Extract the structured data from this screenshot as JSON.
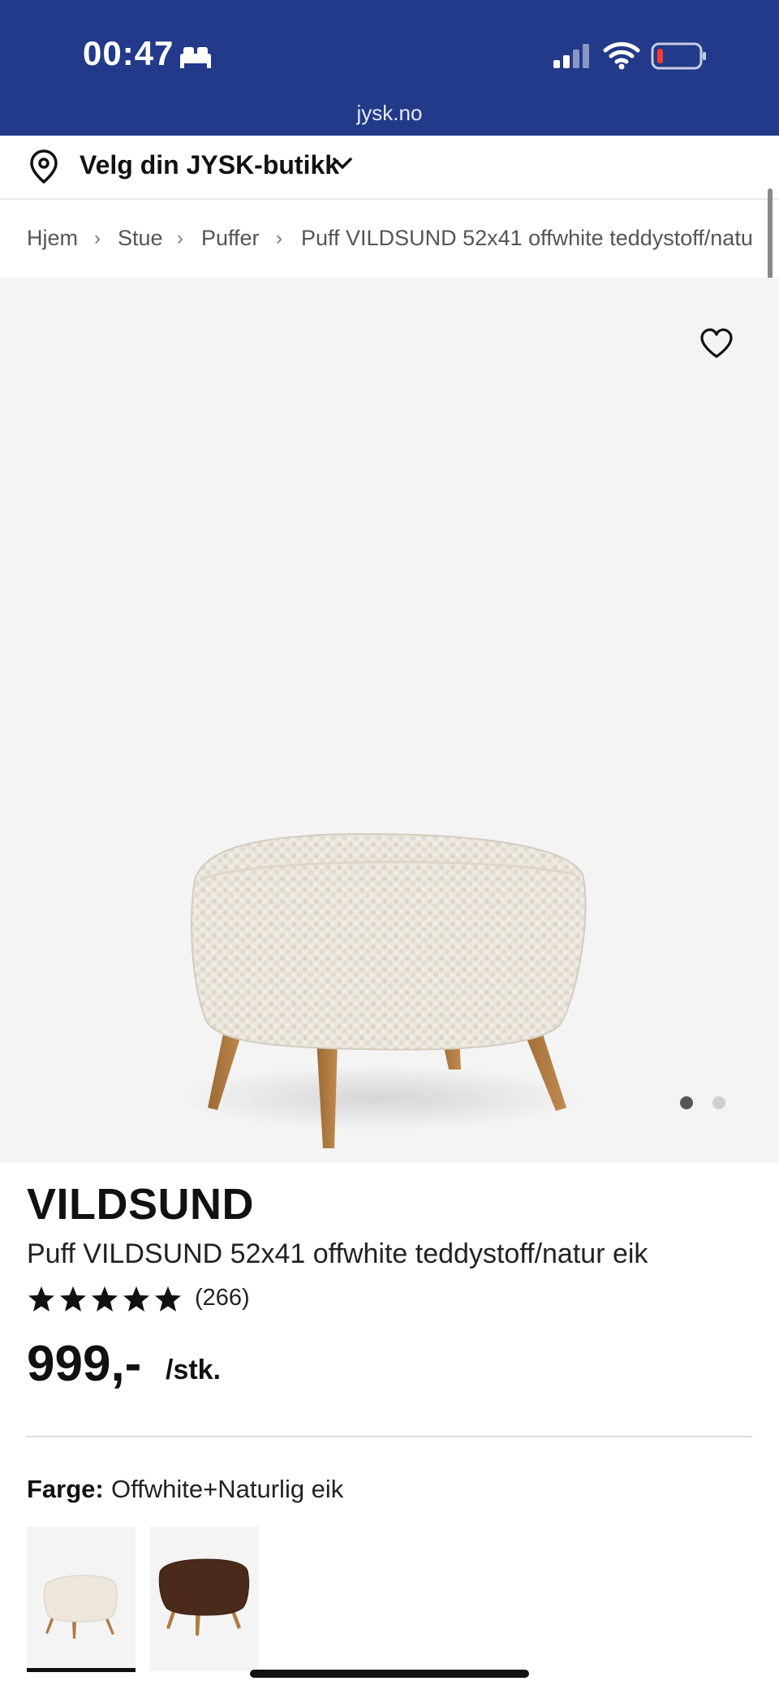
{
  "status_bar": {
    "time": "00:47",
    "icons": [
      "bed-icon",
      "signal-icon",
      "wifi-icon",
      "battery-low-icon"
    ],
    "url": "jysk.no",
    "bg_color": "#233a8a"
  },
  "store_selector": {
    "label": "Velg din JYSK-butikk",
    "icon": "map-pin-icon"
  },
  "breadcrumb": {
    "items": [
      "Hjem",
      "Stue",
      "Puffer",
      "Puff VILDSUND 52x41 offwhite teddystoff/natu"
    ]
  },
  "gallery": {
    "favorite_icon": "heart-outline-icon",
    "image_alt": "Puff VILDSUND offwhite teddystoff",
    "dots_count": 2,
    "active_dot": 1
  },
  "product": {
    "brand": "VILDSUND",
    "title": "Puff VILDSUND 52x41 offwhite teddystoff/natur eik",
    "rating": 5,
    "review_count": "(266)",
    "price": "999,-",
    "unit": "/stk.",
    "color_label": "Farge:",
    "color_value": "Offwhite+Naturlig eik",
    "swatches": [
      "Offwhite+Naturlig eik",
      "Brun+Naturlig eik"
    ],
    "selected_swatch": 0
  }
}
